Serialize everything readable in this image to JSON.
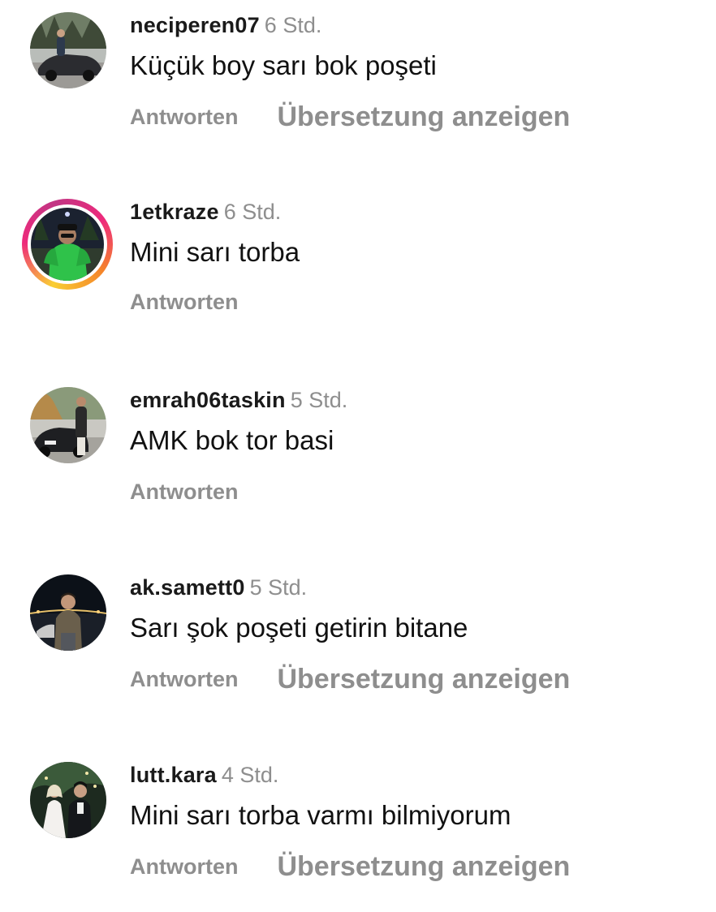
{
  "comments": [
    {
      "username": "neciperen07",
      "time": "6 Std.",
      "text": "Küçük boy sarı bok poşeti",
      "reply": "Antworten",
      "translate": "Übersetzung anzeigen",
      "avatar_icon": "profile-photo-car",
      "story_ring": false
    },
    {
      "username": "1etkraze",
      "time": "6 Std.",
      "text": "Mini sarı torba",
      "reply": "Antworten",
      "translate": "",
      "avatar_icon": "profile-photo-green-jacket",
      "story_ring": true
    },
    {
      "username": "emrah06taskin",
      "time": "5 Std.",
      "text": "AMK bok tor basi",
      "reply": "Antworten",
      "translate": "",
      "avatar_icon": "profile-photo-car",
      "story_ring": false
    },
    {
      "username": "ak.samett0",
      "time": "5 Std.",
      "text": "Sarı şok poşeti getirin bitane",
      "reply": "Antworten",
      "translate": "Übersetzung anzeigen",
      "avatar_icon": "profile-photo-night",
      "story_ring": false
    },
    {
      "username": "lutt.kara",
      "time": "4 Std.",
      "text": "Mini sarı torba varmı bilmiyorum",
      "reply": "Antworten",
      "translate": "Übersetzung anzeigen",
      "avatar_icon": "profile-photo-wedding",
      "story_ring": false
    }
  ],
  "colors": {
    "text": "#111111",
    "secondary": "#8e8e8e",
    "story_ring": [
      "#f9ce34",
      "#ee2a7b",
      "#c13584",
      "#f58529"
    ]
  }
}
